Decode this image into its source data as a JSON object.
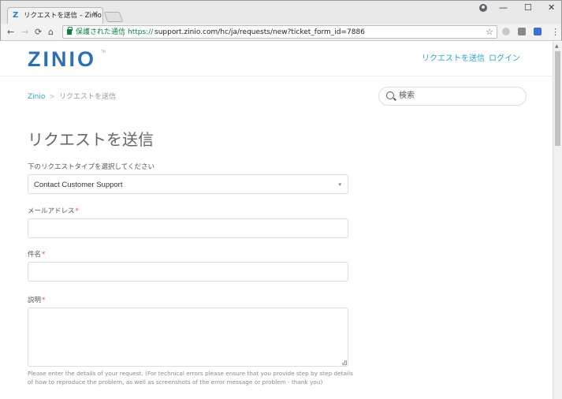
{
  "browser": {
    "tab_title": "リクエストを送信 – Zinio",
    "tab_favicon": "Z",
    "tab_close": "✕",
    "secure_label": "保護された通信",
    "url_scheme": "https://",
    "url_rest": "support.zinio.com/hc/ja/requests/new?ticket_form_id=7886",
    "icons": [
      "back-arrow-icon",
      "forward-arrow-icon",
      "reload-icon",
      "home-icon",
      "lock-icon",
      "star-icon",
      "cloud-extension-icon",
      "puzzle-extension-icon",
      "chat-extension-icon",
      "menu-dots-icon"
    ],
    "window_controls": [
      "—",
      "☐",
      "✕"
    ]
  },
  "header": {
    "logo": "ZINIO",
    "logo_tm": "TM",
    "nav": {
      "submit_request": "リクエストを送信",
      "login": "ログイン"
    }
  },
  "breadcrumb": {
    "home": "Zinio",
    "separator": ">",
    "current": "リクエストを送信"
  },
  "search": {
    "placeholder": "検索"
  },
  "form": {
    "title": "リクエストを送信",
    "type_label": "下のリクエストタイプを選択してください",
    "type_value": "Contact Customer Support",
    "email_label": "メールアドレス",
    "subject_label": "件名",
    "description_label": "説明",
    "required_mark": "*",
    "description_hint": "Please enter the details of your request. (For technical errors please ensure that you provide step by step details of how to reproduce the problem, as well as screenshots of the error message or problem - thank you)"
  },
  "colors": {
    "brand": "#2b6fb6",
    "link": "#2ba3d6",
    "required": "#e34f4f",
    "secure_green": "#0b8043"
  }
}
